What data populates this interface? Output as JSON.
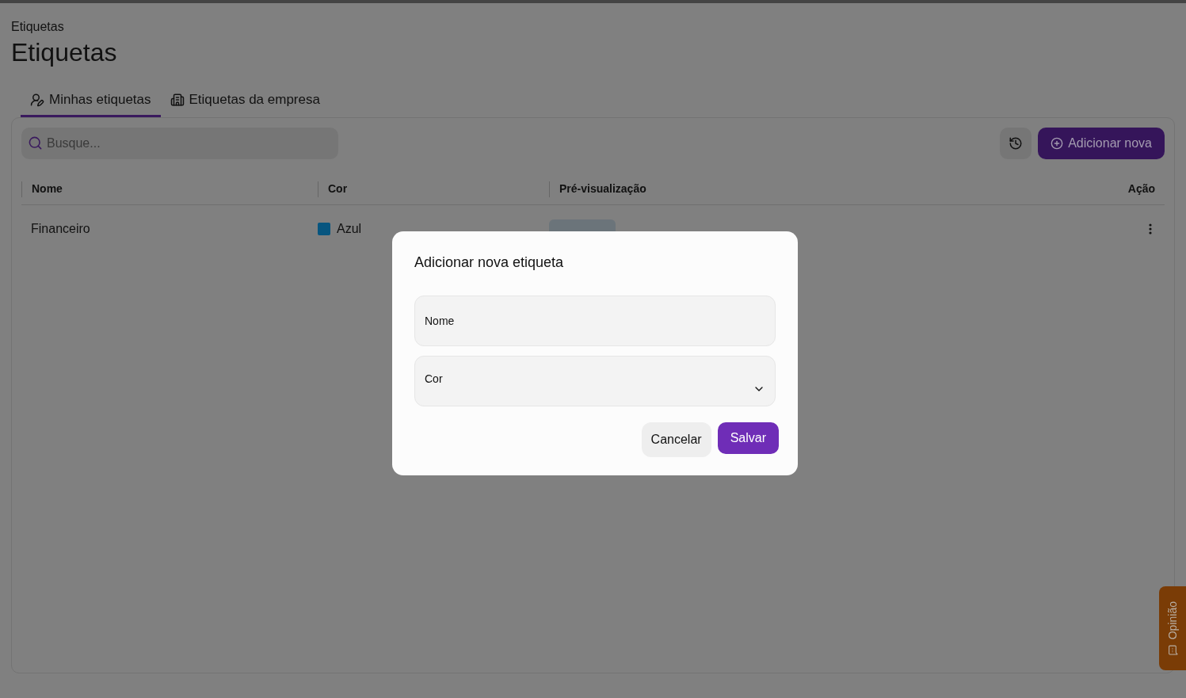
{
  "breadcrumb": "Etiquetas",
  "title": "Etiquetas",
  "tabs": [
    {
      "label": "Minhas etiquetas",
      "kind": "user",
      "selected": true
    },
    {
      "label": "Etiquetas da empresa",
      "kind": "company",
      "selected": false
    }
  ],
  "search": {
    "placeholder": "Busque..."
  },
  "add_button": "Adicionar nova",
  "table": {
    "columns": [
      "Nome",
      "Cor",
      "Pré-visualização",
      "Ação"
    ],
    "rows": [
      {
        "name": "Financeiro",
        "color_name": "Azul",
        "color": "#07557f"
      }
    ]
  },
  "dialog": {
    "title": "Adicionar nova etiqueta",
    "fields": [
      {
        "label": "Nome",
        "kind": "text"
      },
      {
        "label": "Cor",
        "kind": "select"
      }
    ],
    "cancel": "Cancelar",
    "save": "Salvar"
  },
  "feedback": "Opinião"
}
